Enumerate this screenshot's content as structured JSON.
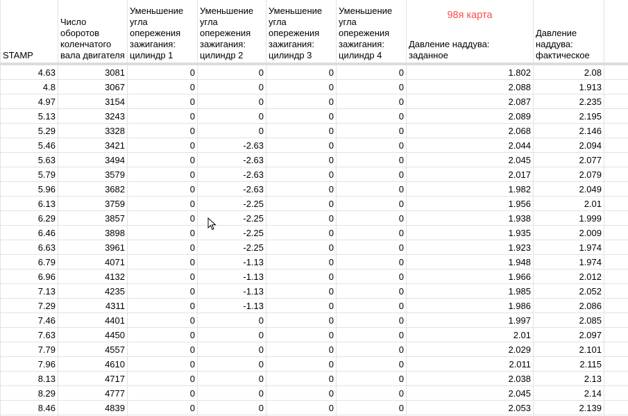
{
  "headers": [
    {
      "key": "stamp",
      "label": "STAMP"
    },
    {
      "key": "rpm",
      "label": "Число оборотов коленчатого вала двигателя"
    },
    {
      "key": "cyl1",
      "label": "Уменьшение угла опережения зажигания: цилиндр 1"
    },
    {
      "key": "cyl2",
      "label": "Уменьшение угла опережения зажигания: цилиндр 2"
    },
    {
      "key": "cyl3",
      "label": "Уменьшение угла опережения зажигания: цилиндр 3"
    },
    {
      "key": "cyl4",
      "label": "Уменьшение угла опережения зажигания: цилиндр 4"
    },
    {
      "key": "boost_set",
      "label": "Давление наддува: заданное",
      "note": "98я карта"
    },
    {
      "key": "boost_actual",
      "label": "Давление наддува: фактическое"
    }
  ],
  "rows": [
    [
      "4.63",
      "3081",
      "0",
      "0",
      "0",
      "0",
      "1.802",
      "2.08"
    ],
    [
      "4.8",
      "3067",
      "0",
      "0",
      "0",
      "0",
      "2.088",
      "1.913"
    ],
    [
      "4.97",
      "3154",
      "0",
      "0",
      "0",
      "0",
      "2.087",
      "2.235"
    ],
    [
      "5.13",
      "3243",
      "0",
      "0",
      "0",
      "0",
      "2.089",
      "2.195"
    ],
    [
      "5.29",
      "3328",
      "0",
      "0",
      "0",
      "0",
      "2.068",
      "2.146"
    ],
    [
      "5.46",
      "3421",
      "0",
      "-2.63",
      "0",
      "0",
      "2.044",
      "2.094"
    ],
    [
      "5.63",
      "3494",
      "0",
      "-2.63",
      "0",
      "0",
      "2.045",
      "2.077"
    ],
    [
      "5.79",
      "3579",
      "0",
      "-2.63",
      "0",
      "0",
      "2.017",
      "2.079"
    ],
    [
      "5.96",
      "3682",
      "0",
      "-2.63",
      "0",
      "0",
      "1.982",
      "2.049"
    ],
    [
      "6.13",
      "3759",
      "0",
      "-2.25",
      "0",
      "0",
      "1.956",
      "2.01"
    ],
    [
      "6.29",
      "3857",
      "0",
      "-2.25",
      "0",
      "0",
      "1.938",
      "1.999"
    ],
    [
      "6.46",
      "3898",
      "0",
      "-2.25",
      "0",
      "0",
      "1.935",
      "2.009"
    ],
    [
      "6.63",
      "3961",
      "0",
      "-2.25",
      "0",
      "0",
      "1.923",
      "1.974"
    ],
    [
      "6.79",
      "4071",
      "0",
      "-1.13",
      "0",
      "0",
      "1.948",
      "1.974"
    ],
    [
      "6.96",
      "4132",
      "0",
      "-1.13",
      "0",
      "0",
      "1.966",
      "2.012"
    ],
    [
      "7.13",
      "4235",
      "0",
      "-1.13",
      "0",
      "0",
      "1.985",
      "2.052"
    ],
    [
      "7.29",
      "4311",
      "0",
      "-1.13",
      "0",
      "0",
      "1.986",
      "2.086"
    ],
    [
      "7.46",
      "4401",
      "0",
      "0",
      "0",
      "0",
      "1.997",
      "2.085"
    ],
    [
      "7.63",
      "4450",
      "0",
      "0",
      "0",
      "0",
      "2.01",
      "2.097"
    ],
    [
      "7.79",
      "4557",
      "0",
      "0",
      "0",
      "0",
      "2.029",
      "2.101"
    ],
    [
      "7.96",
      "4610",
      "0",
      "0",
      "0",
      "0",
      "2.011",
      "2.115"
    ],
    [
      "8.13",
      "4717",
      "0",
      "0",
      "0",
      "0",
      "2.038",
      "2.13"
    ],
    [
      "8.29",
      "4777",
      "0",
      "0",
      "0",
      "0",
      "2.045",
      "2.14"
    ],
    [
      "8.46",
      "4839",
      "0",
      "0",
      "0",
      "0",
      "2.053",
      "2.139"
    ]
  ],
  "colors": {
    "note": "#ff4a4a",
    "grid": "#e2e2e2",
    "freeze": "#dadce0"
  },
  "cursor_icon": "mouse-pointer-icon"
}
